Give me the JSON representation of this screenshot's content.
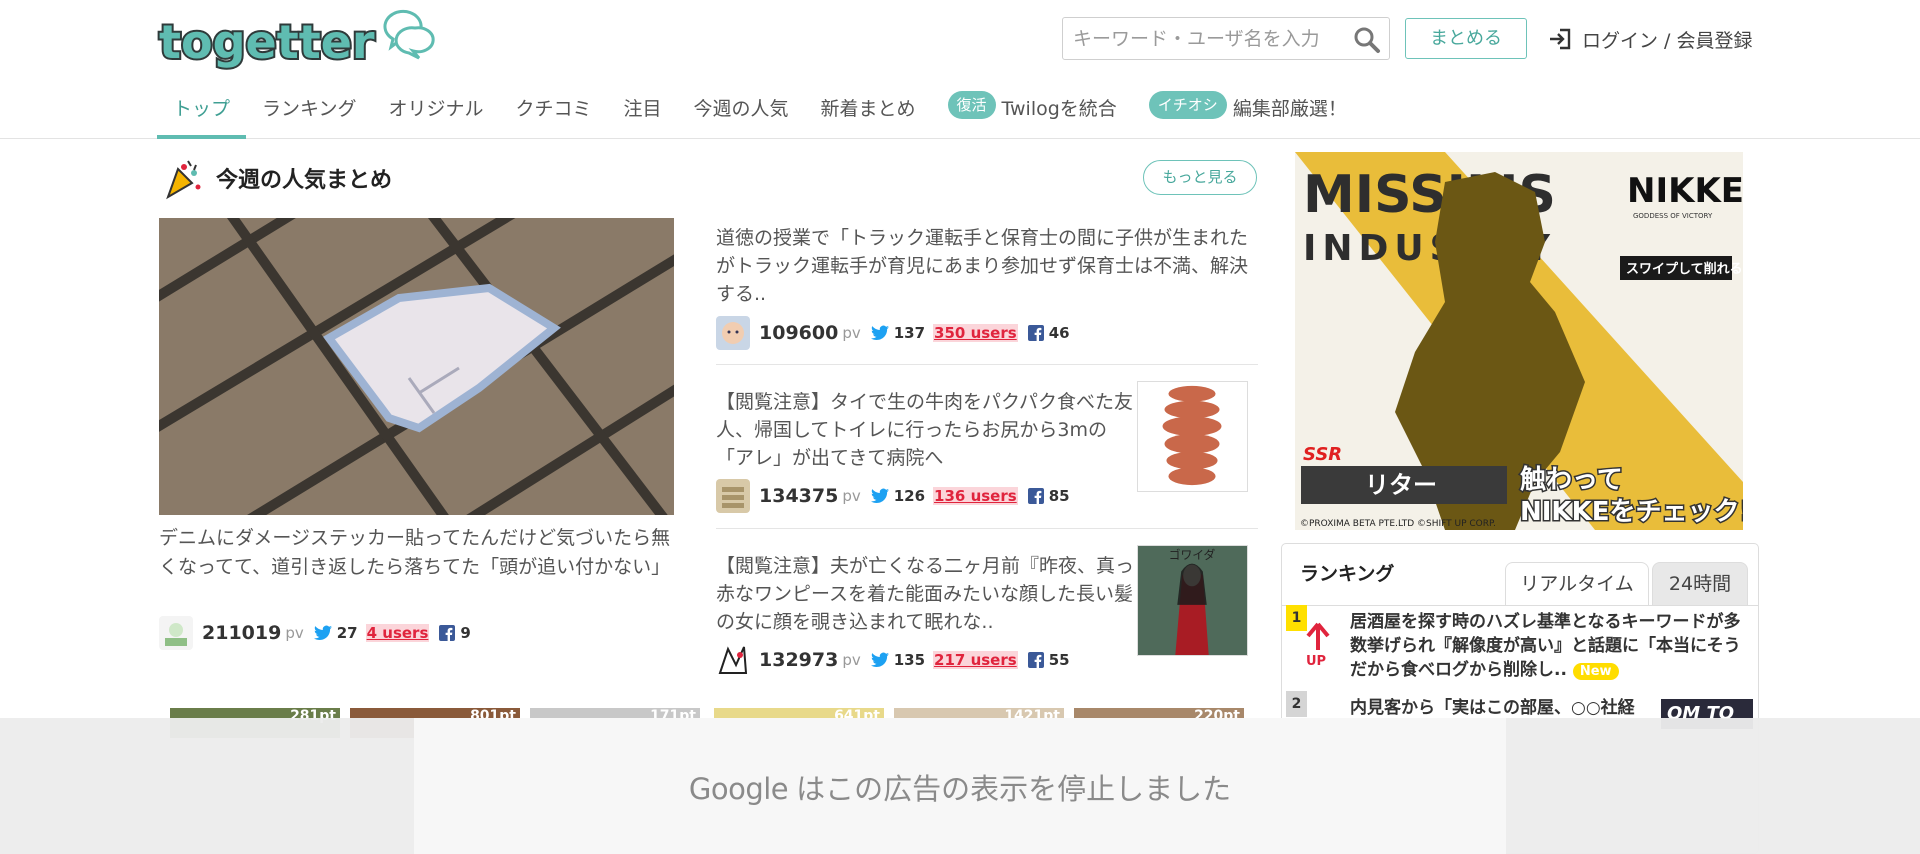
{
  "header": {
    "logo_text": "togetter",
    "search_placeholder": "キーワード・ユーザ名を入力",
    "matome_label": "まとめる",
    "login_label": "ログイン / 会員登録"
  },
  "nav": [
    {
      "label": "トップ",
      "active": true
    },
    {
      "label": "ランキング"
    },
    {
      "label": "オリジナル"
    },
    {
      "label": "クチコミ"
    },
    {
      "label": "注目"
    },
    {
      "label": "今週の人気"
    },
    {
      "label": "新着まとめ"
    },
    {
      "badge": "復活",
      "label": "Twilogを統合"
    },
    {
      "badge": "イチオシ",
      "label": "編集部厳選！"
    }
  ],
  "section": {
    "title": "今週の人気まとめ",
    "more_label": "もっと見る"
  },
  "featured": {
    "title": "デニムにダメージステッカー貼ってたんだけど気づいたら無くなってて、道引き返したら落ちてた「頭が追い付かない」",
    "pv": "211019",
    "pv_label": "pv",
    "tweets": "27",
    "users": "4 users",
    "fb": "9"
  },
  "articles": [
    {
      "title": "道徳の授業で「トラック運転手と保育士の間に子供が生まれたがトラック運転手が育児にあまり参加せず保育士は不満、解決する..",
      "pv": "109600",
      "pv_label": "pv",
      "tweets": "137",
      "users": "350 users",
      "fb": "46"
    },
    {
      "title": "【閲覧注意】タイで生の牛肉をパクパク食べた友人、帰国してトイレに行ったらお尻から3mの「アレ」が出てきて病院へ",
      "pv": "134375",
      "pv_label": "pv",
      "tweets": "126",
      "users": "136 users",
      "fb": "85"
    },
    {
      "title": "【閲覧注意】夫が亡くなる二ヶ月前『昨夜、真っ赤なワンピースを着た能面みたいな顔した長い髪の女に顔を覗き込まれて眠れな..",
      "pv": "132973",
      "pv_label": "pv",
      "tweets": "135",
      "users": "217 users",
      "fb": "55",
      "thumb_text": "ゴワイダ"
    }
  ],
  "ad": {
    "text_top": "MISSILIS",
    "text_mid": "INDUSTRY",
    "brand": "NIKKE",
    "brand_sub": "GODDESS OF VICTORY",
    "swipe": "スワイプして削れる",
    "rarity": "SSR",
    "char_name": "リター",
    "cta_1": "触わって",
    "cta_2": "NIKKEをチェック!",
    "copyright": "©PROXIMA BETA PTE.LTD ©SHIFT UP CORP."
  },
  "ranking": {
    "title": "ランキング",
    "tabs": [
      "リアルタイム",
      "24時間"
    ],
    "items": [
      {
        "rank": "1",
        "trend": "UP",
        "title": "居酒屋を探す時のハズレ基準となるキーワードが多数挙げられ『解像度が高い』と話題に「本当にそうだから食べログから削除し..",
        "badge": "New"
      },
      {
        "rank": "2",
        "title": "内見客から「実はこの部屋、○○社経",
        "thumb_text": "OM TO"
      }
    ]
  },
  "strip": [
    "281pt",
    "801pt",
    "171pt",
    "641pt",
    "1421pt",
    "220pt"
  ],
  "overlay": {
    "google": "Google",
    "message": "はこの広告の表示を停止しました"
  },
  "colors": {
    "accent": "#5fbcb1",
    "users_red": "#e0243d",
    "twitter": "#1da1f2",
    "facebook": "#3b5998"
  }
}
